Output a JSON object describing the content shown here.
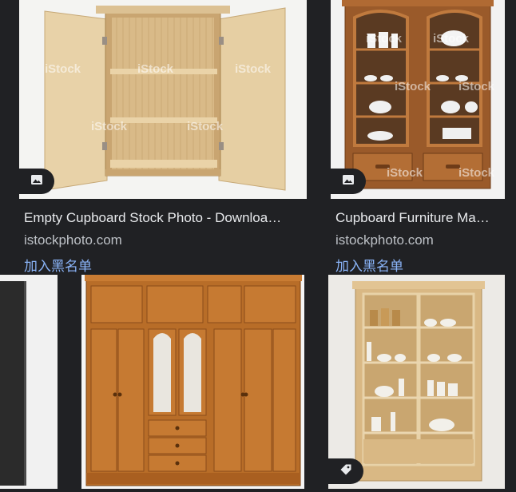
{
  "results": [
    {
      "title": "Empty Cupboard Stock Photo - Downloa…",
      "source": "istockphoto.com",
      "action": "加入黑名单",
      "badge_icon": "image-icon",
      "watermark": "iStock"
    },
    {
      "title": "Cupboard Furniture Ma…",
      "source": "istockphoto.com",
      "action": "加入黑名单",
      "badge_icon": "image-icon",
      "watermark": "iStock"
    },
    {
      "badge_icon": ""
    },
    {
      "badge_icon": ""
    },
    {
      "badge_icon": "tag-icon"
    }
  ],
  "colors": {
    "background": "#202124",
    "title": "#e8eaed",
    "source": "#bdc1c6",
    "link": "#8ab4f8"
  }
}
